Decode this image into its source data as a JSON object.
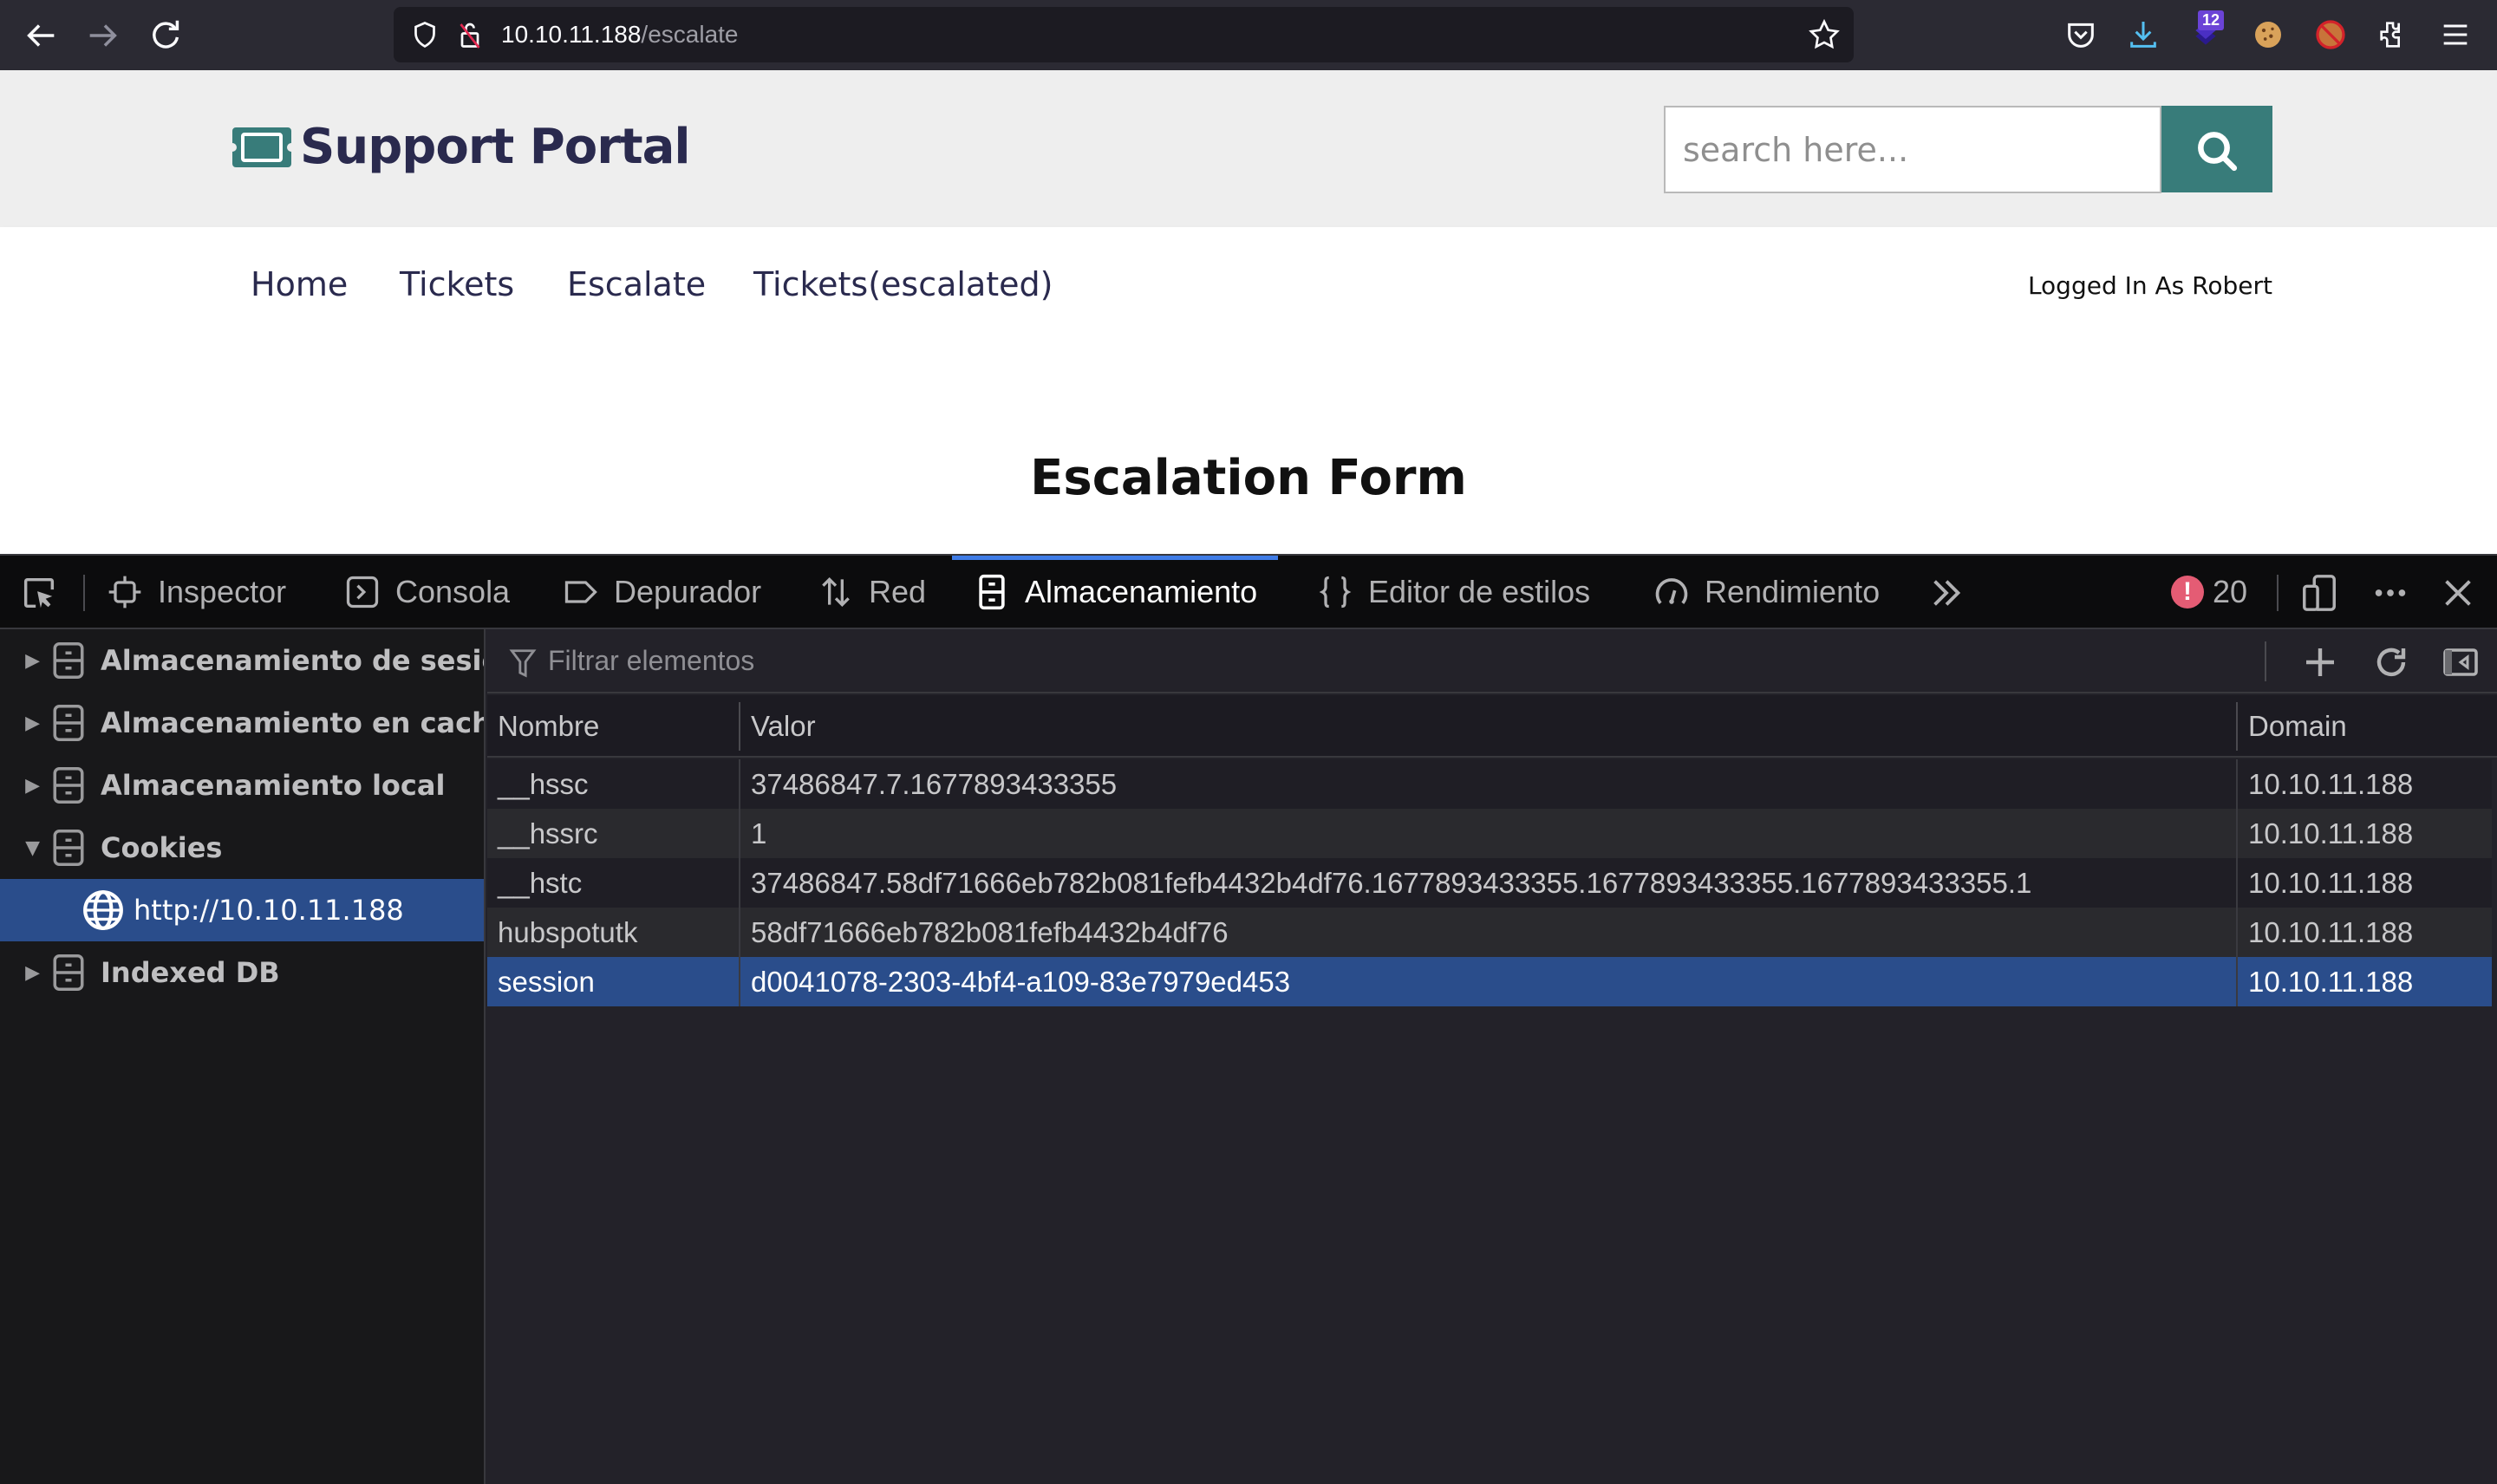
{
  "browser": {
    "url_host": "10.10.11.188",
    "url_path": "/escalate",
    "extension_badge": "12"
  },
  "site": {
    "logo_text": "Support Portal",
    "search_placeholder": "search here...",
    "nav": [
      "Home",
      "Tickets",
      "Escalate",
      "Tickets(escalated)"
    ],
    "logged_in": "Logged In As Robert",
    "page_title": "Escalation Form",
    "accent_color": "#387c7a",
    "text_color": "#2a2a4e"
  },
  "devtools": {
    "tabs": [
      "Inspector",
      "Consola",
      "Depurador",
      "Red",
      "Almacenamiento",
      "Editor de estilos",
      "Rendimiento"
    ],
    "active_tab": "Almacenamiento",
    "error_count": "20",
    "sidebar": {
      "items": [
        {
          "label": "Almacenamiento de sesión",
          "expanded": false
        },
        {
          "label": "Almacenamiento en caché",
          "expanded": false
        },
        {
          "label": "Almacenamiento local",
          "expanded": false
        },
        {
          "label": "Cookies",
          "expanded": true
        },
        {
          "label": "Indexed DB",
          "expanded": false
        }
      ],
      "selected_child": "http://10.10.11.188"
    },
    "filter_placeholder": "Filtrar elementos",
    "table": {
      "columns": [
        "Nombre",
        "Valor",
        "Domain"
      ],
      "rows": [
        {
          "name": "__hssc",
          "value": "37486847.7.1677893433355",
          "domain": "10.10.11.188"
        },
        {
          "name": "__hssrc",
          "value": "1",
          "domain": "10.10.11.188"
        },
        {
          "name": "__hstc",
          "value": "37486847.58df71666eb782b081fefb4432b4df76.1677893433355.1677893433355.1677893433355.1",
          "domain": "10.10.11.188"
        },
        {
          "name": "hubspotutk",
          "value": "58df71666eb782b081fefb4432b4df76",
          "domain": "10.10.11.188"
        },
        {
          "name": "session",
          "value": "d0041078-2303-4bf4-a109-83e7979ed453",
          "domain": "10.10.11.188",
          "selected": true
        }
      ]
    }
  }
}
